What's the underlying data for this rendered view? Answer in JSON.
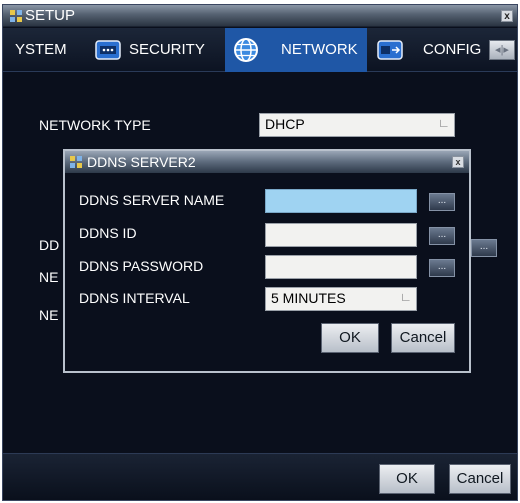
{
  "window": {
    "title": "SETUP",
    "close": "x"
  },
  "tabs": [
    {
      "label": "YSTEM",
      "active": false
    },
    {
      "label": "SECURITY",
      "active": false
    },
    {
      "label": "NETWORK",
      "active": true
    },
    {
      "label": "CONFIG",
      "active": false
    }
  ],
  "network": {
    "type_label": "NETWORK TYPE",
    "type_value": "DHCP",
    "partial_labels": [
      "DD",
      "NE",
      "NE"
    ]
  },
  "dialog": {
    "title": "DDNS SERVER2",
    "close": "x",
    "server_name_label": "DDNS SERVER NAME",
    "server_name_value": "",
    "id_label": "DDNS ID",
    "id_value": "",
    "password_label": "DDNS PASSWORD",
    "password_value": "",
    "interval_label": "DDNS INTERVAL",
    "interval_value": "5 MINUTES",
    "browse": "...",
    "ok": "OK",
    "cancel": "Cancel"
  },
  "footer": {
    "ok": "OK",
    "cancel": "Cancel"
  },
  "colors": {
    "active_tab": "#1f57a6",
    "highlight_field": "#9fd3f2",
    "background": "#0a0f1c"
  },
  "icons": [
    "app-icon",
    "security-icon",
    "globe-icon",
    "config-icon",
    "scroll-arrows-icon",
    "dropdown-arrow-icon"
  ]
}
